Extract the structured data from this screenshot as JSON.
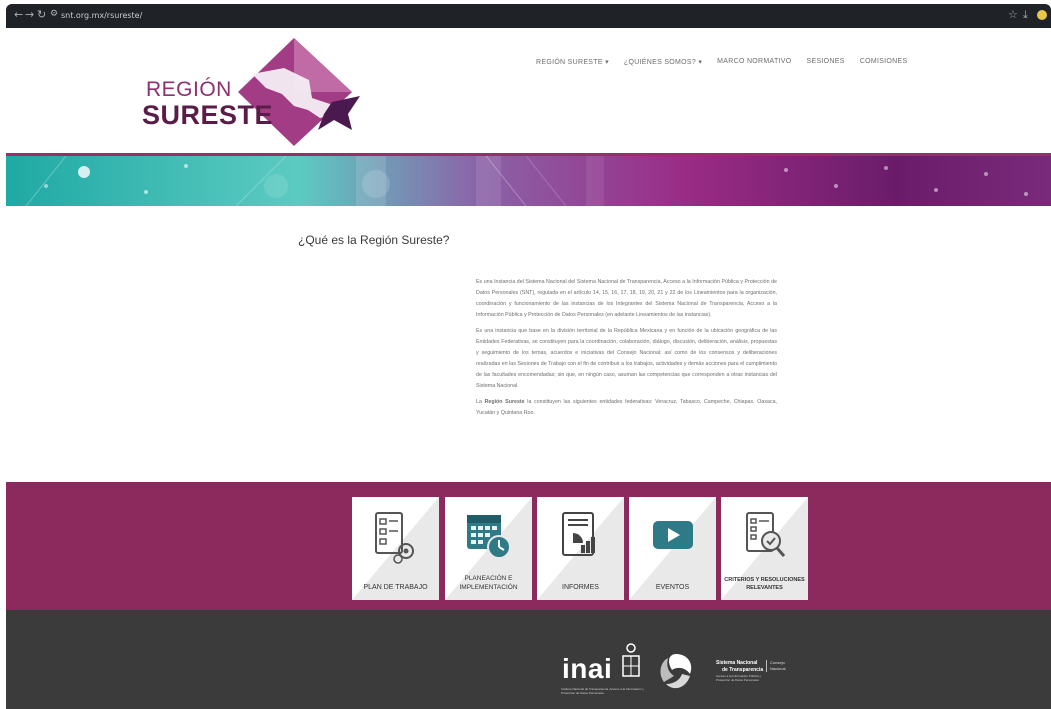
{
  "browser": {
    "url": "snt.org.mx/rsureste/"
  },
  "logo": {
    "line1": "REGIÓN",
    "line2": "SURESTE"
  },
  "nav": {
    "items": [
      {
        "label": "REGIÓN SURESTE ▾"
      },
      {
        "label": "¿QUIÉNES SOMOS? ▾"
      },
      {
        "label": "MARCO NORMATIVO"
      },
      {
        "label": "SESIONES"
      },
      {
        "label": "COMISIONES"
      }
    ]
  },
  "main": {
    "title": "¿Qué es la Región Sureste?",
    "p1": "Es una Instancia del Sistema Nacional del Sistema Nacional de Transparencia, Acceso a la Información Pública y Protección de Datos Personales (SNT), regulada en el artículo 14, 15, 16, 17, 18, 19, 20, 21 y 22 de los Lineamientos para la organización, coordinación y funcionamiento de las instancias de los Integrantes del Sistema Nacional de Transparencia, Acceso a la Información Pública y Protección de Datos Personales (en adelante Lineamientos de las instancias).",
    "p2": "Es una instancia que base en la división territorial de la República Mexicana y en función de la ubicación geográfica de las Entidades Federativas, se constituyen para la coordinación, colaboración, diálogo, discusión, deliberación, análisis, propuestas y seguimiento de los temas, acuerdos e iniciativas del Consejo Nacional; así como de los consensos y deliberaciones realizadas en las Sesiones de Trabajo con el fin de contribuir a los trabajos, actividades y demás acciones para el cumplimiento de las facultades encomendadas; sin que, en ningún caso, asuman las competencias que corresponden a otras instancias del Sistema Nacional.",
    "p3_prefix": "La ",
    "p3_bold": "Región Sureste",
    "p3_rest": " la constituyen las siguientes entidades federativas: Veracruz, Tabasco, Campeche, Chiapas, Oaxaca, Yucatán y Quintana Roo."
  },
  "tiles": {
    "t1": "PLAN DE TRABAJO",
    "t2a": "PLANEACIÓN E",
    "t2b": "IMPLEMENTACIÓN",
    "t3": "INFORMES",
    "t4": "EVENTOS",
    "t5a": "CRITERIOS Y RESOLUCIONES",
    "t5b": "RELEVANTES"
  },
  "footer": {
    "inai": "inai",
    "inai_sub": "Instituto Nacional de Transparencia, Acceso a la Información y Protección de Datos Personales",
    "snt_line1": "Sistema Nacional",
    "snt_line2": "de Transparencia",
    "snt_line3": "Acceso a la Información Pública y Protección de Datos Personales",
    "snt_line4a": "Consejo",
    "snt_line4b": "Nacional"
  },
  "colors": {
    "brand_magenta": "#8c2a5e",
    "footer_gray": "#3b3b3b",
    "teal": "#2bb7b0"
  }
}
